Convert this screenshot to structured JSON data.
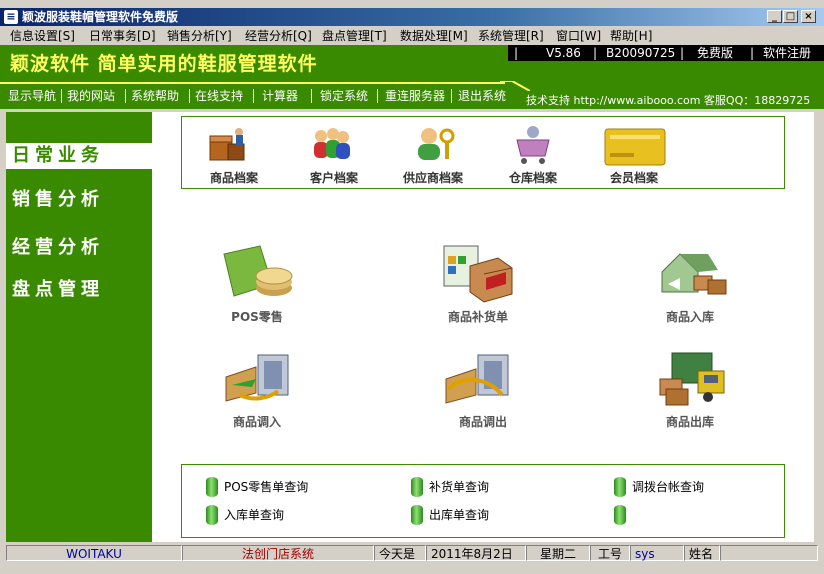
{
  "window": {
    "title": "颖波服装鞋帽管理软件免费版"
  },
  "menu": [
    {
      "label": "信息设置[S]"
    },
    {
      "label": "日常事务[D]"
    },
    {
      "label": "销售分析[Y]"
    },
    {
      "label": "经营分析[Q]"
    },
    {
      "label": "盘点管理[T]"
    },
    {
      "label": "数据处理[M]"
    },
    {
      "label": "系统管理[R]"
    },
    {
      "label": "窗口[W]"
    },
    {
      "label": "帮助[H]"
    }
  ],
  "banner": {
    "text": "颖波软件  简单实用的鞋服管理软件",
    "version": "V5.86",
    "build": "B20090725",
    "edition": "免费版",
    "register": "软件注册"
  },
  "toolbar": {
    "items": [
      {
        "label": "显示导航"
      },
      {
        "label": "我的网站"
      },
      {
        "label": "系统帮助"
      },
      {
        "label": "在线支持"
      },
      {
        "label": "计算器"
      },
      {
        "label": "锁定系统"
      },
      {
        "label": "重连服务器"
      },
      {
        "label": "退出系统"
      }
    ],
    "support": "技术支持 http://www.aibooo.com 客服QQ：18829725"
  },
  "sidebar": {
    "items": [
      {
        "label": "日常业务"
      },
      {
        "label": "销售分析"
      },
      {
        "label": "经营分析"
      },
      {
        "label": "盘点管理"
      }
    ]
  },
  "quick": [
    {
      "label": "商品档案",
      "icon": "boxes-icon"
    },
    {
      "label": "客户档案",
      "icon": "people-icon"
    },
    {
      "label": "供应商档案",
      "icon": "supplier-key-icon"
    },
    {
      "label": "仓库档案",
      "icon": "cart-icon"
    },
    {
      "label": "会员档案",
      "icon": "member-card-icon"
    }
  ],
  "main": [
    {
      "label": "POS零售",
      "icon": "coins-icon"
    },
    {
      "label": "商品补货单",
      "icon": "restock-icon"
    },
    {
      "label": "商品入库",
      "icon": "warehouse-in-icon"
    },
    {
      "label": "商品调入",
      "icon": "transfer-in-icon"
    },
    {
      "label": "商品调出",
      "icon": "transfer-out-icon"
    },
    {
      "label": "商品出库",
      "icon": "truck-icon"
    }
  ],
  "queries": [
    {
      "label": "POS零售单查询"
    },
    {
      "label": "补货单查询"
    },
    {
      "label": "调拨台帐查询"
    },
    {
      "label": "入库单查询"
    },
    {
      "label": "出库单查询"
    },
    {
      "label": ""
    }
  ],
  "status": {
    "user": "WOITAKU",
    "store": "法创门店系统",
    "today_label": "今天是",
    "date": "2011年8月2日",
    "weekday": "星期二",
    "id_label": "工号",
    "id_value": "sys",
    "name_label": "姓名"
  },
  "colors": {
    "brand_green": "#3a8a00",
    "banner_text": "#ffff60",
    "title_bar": "#0a246a"
  }
}
